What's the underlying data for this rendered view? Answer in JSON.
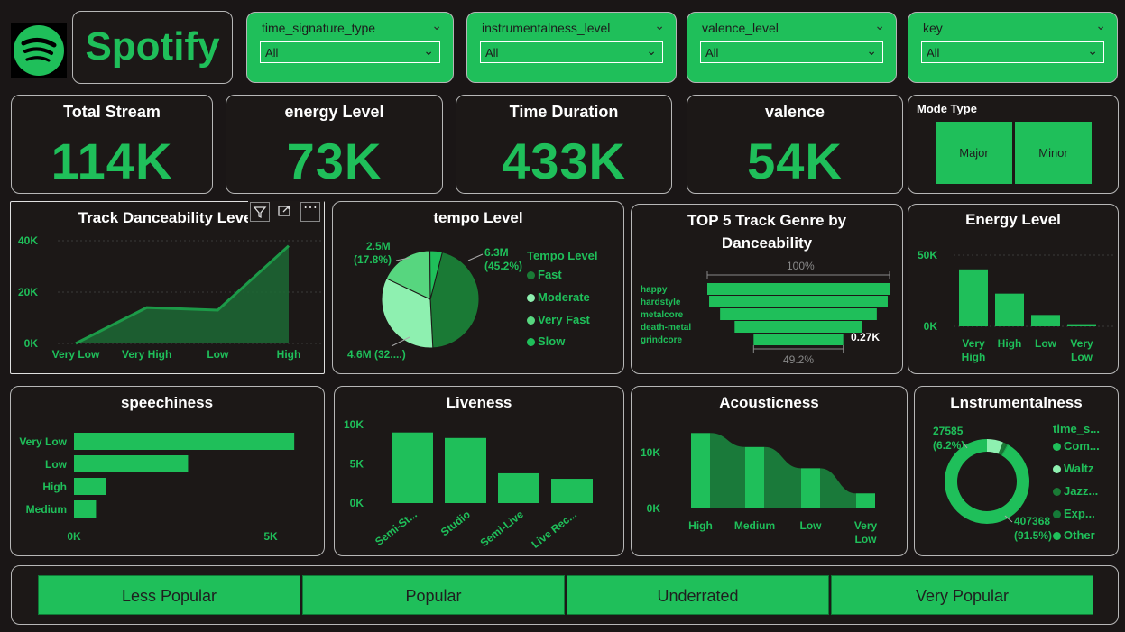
{
  "header": {
    "brand": "Spotify",
    "logo_icon": "spotify-logo-icon"
  },
  "slicers": [
    {
      "label": "time_signature_type",
      "value": "All"
    },
    {
      "label": "instrumentalness_level",
      "value": "All"
    },
    {
      "label": "valence_level",
      "value": "All"
    },
    {
      "label": "key",
      "value": "All"
    }
  ],
  "kpis": [
    {
      "title": "Total Stream",
      "value": "114K"
    },
    {
      "title": "energy Level",
      "value": "73K"
    },
    {
      "title": "Time Duration",
      "value": "433K"
    },
    {
      "title": "valence",
      "value": "54K"
    }
  ],
  "mode": {
    "title": "Mode Type",
    "options": [
      "Major",
      "Minor"
    ]
  },
  "danceability": {
    "title": "Track Danceability Level",
    "toolbar": [
      "filter-icon",
      "focus-mode-icon",
      "more-options-icon"
    ],
    "yticks": [
      "40K",
      "20K",
      "0K"
    ],
    "chart_data": {
      "type": "area",
      "categories": [
        "Very Low",
        "Very High",
        "Low",
        "High"
      ],
      "values": [
        0,
        14000,
        13000,
        38000
      ],
      "ylim": [
        0,
        40000
      ]
    }
  },
  "tempo": {
    "title": "tempo Level",
    "legend_title": "Tempo Level",
    "labels": [
      "6.3M",
      "(45.2%)",
      "2.5M",
      "(17.8%)",
      "4.6M (32....)"
    ],
    "chart_data": {
      "type": "pie",
      "categories": [
        "Fast",
        "Moderate",
        "Very Fast",
        "Slow"
      ],
      "values": [
        45.2,
        32.9,
        17.8,
        4.1
      ]
    },
    "colors": [
      "#1a7a35",
      "#8ef0b0",
      "#57d67f",
      "#1fbf5a"
    ]
  },
  "genre": {
    "title_line1": "TOP 5 Track Genre by",
    "title_line2": "Danceability",
    "top_pct": "100%",
    "bottom_pct": "49.2%",
    "last_value": "0.27K",
    "chart_data": {
      "type": "bar",
      "categories": [
        "happy",
        "hardstyle",
        "metalcore",
        "death-metal",
        "grindcore"
      ],
      "values": [
        100,
        98,
        86,
        70,
        49.2
      ]
    }
  },
  "energy": {
    "title": "Energy Level",
    "yticks": [
      "50K",
      "0K"
    ],
    "xlabels": [
      [
        "Very",
        "High"
      ],
      [
        "High"
      ],
      [
        "Low"
      ],
      [
        "Very",
        "Low"
      ]
    ],
    "chart_data": {
      "type": "bar",
      "categories": [
        "Very High",
        "High",
        "Low",
        "Very Low"
      ],
      "values": [
        40000,
        23000,
        8000,
        1500
      ],
      "ylim": [
        0,
        50000
      ]
    }
  },
  "speechiness": {
    "title": "speechiness",
    "xticks": [
      "0K",
      "5K"
    ],
    "chart_data": {
      "type": "bar",
      "categories": [
        "Very Low",
        "Low",
        "High",
        "Medium"
      ],
      "values": [
        5600,
        2900,
        820,
        560
      ],
      "xlim": [
        0,
        5000
      ]
    }
  },
  "liveness": {
    "title": "Liveness",
    "yticks": [
      "10K",
      "5K",
      "0K"
    ],
    "xlabels": [
      "Semi-St...",
      "Studio",
      "Semi-Live",
      "Live Rec..."
    ],
    "chart_data": {
      "type": "bar",
      "categories": [
        "Semi-St...",
        "Studio",
        "Semi-Live",
        "Live Rec..."
      ],
      "values": [
        9000,
        8300,
        3800,
        3100
      ],
      "ylim": [
        0,
        10000
      ]
    }
  },
  "acousticness": {
    "title": "Acousticness",
    "yticks": [
      "10K",
      "0K"
    ],
    "xlabels": [
      [
        "High"
      ],
      [
        "Medium"
      ],
      [
        "Low"
      ],
      [
        "Very",
        "Low"
      ]
    ],
    "chart_data": {
      "type": "bar",
      "categories": [
        "High",
        "Medium",
        "Low",
        "Very Low"
      ],
      "values": [
        13500,
        11000,
        7200,
        2700
      ],
      "ylim": [
        0,
        10000
      ]
    }
  },
  "instrumentalness": {
    "title": "Lnstrumentalness",
    "legend_title": "time_s...",
    "legend": [
      "Com...",
      "Waltz",
      "Jazz...",
      "Exp...",
      "Other"
    ],
    "labels": [
      "27585",
      "(6.2%)",
      "407368",
      "(91.5%)"
    ],
    "chart_data": {
      "type": "pie",
      "categories": [
        "Com...",
        "Waltz",
        "Jazz...",
        "Exp...",
        "Other"
      ],
      "values": [
        407368,
        27585,
        6000,
        2500,
        1500
      ]
    },
    "colors": [
      "#1fbf5a",
      "#8ef0b0",
      "#1a7a35",
      "#157a38",
      "#1fbf5a"
    ]
  },
  "popularity": [
    "Less Popular",
    "Popular",
    "Underrated",
    "Very Popular"
  ]
}
